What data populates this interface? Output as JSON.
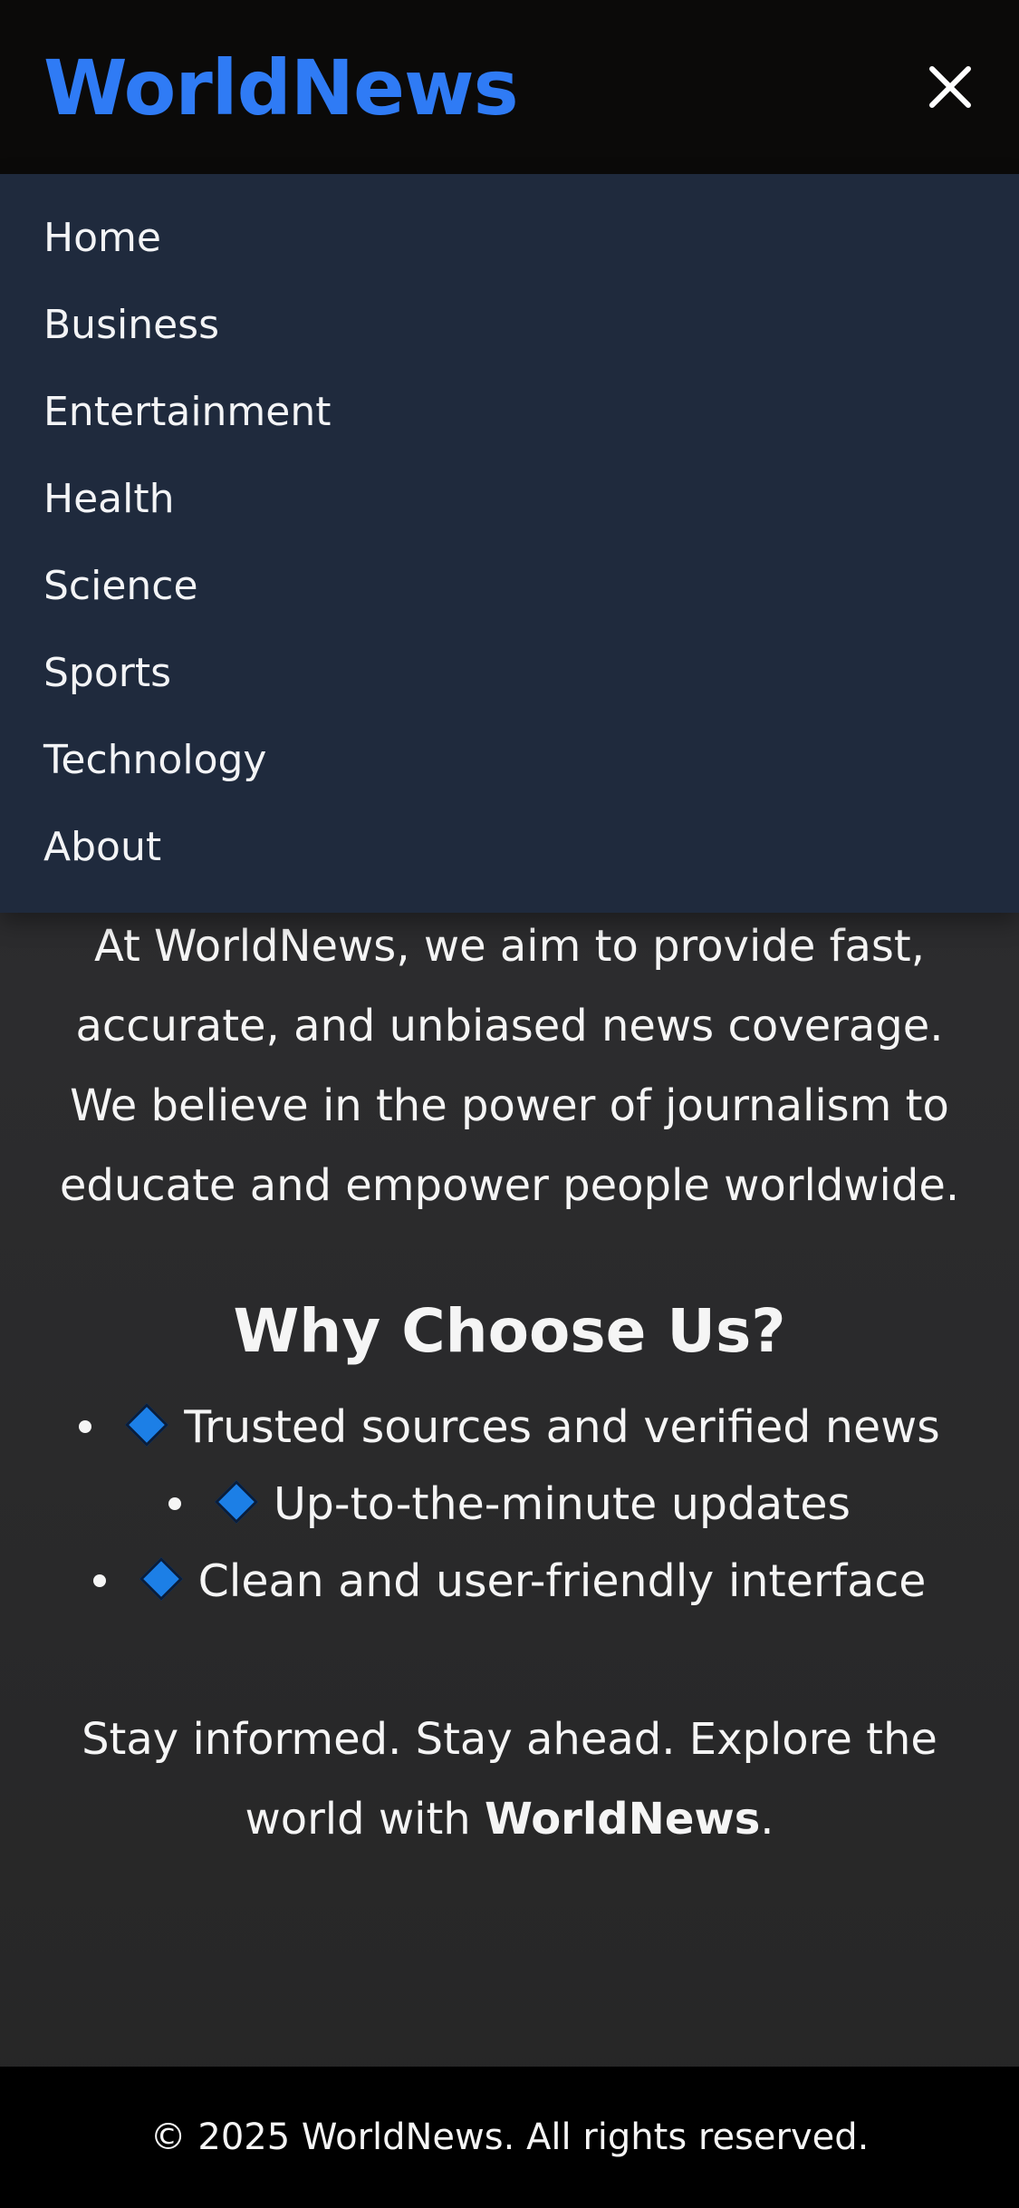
{
  "header": {
    "logo": "WorldNews",
    "close_icon": "close-icon"
  },
  "nav": {
    "items": [
      {
        "label": "Home"
      },
      {
        "label": "Business"
      },
      {
        "label": "Entertainment"
      },
      {
        "label": "Health"
      },
      {
        "label": "Science"
      },
      {
        "label": "Sports"
      },
      {
        "label": "Technology"
      },
      {
        "label": "About"
      }
    ]
  },
  "main": {
    "mission": "At WorldNews, we aim to provide fast, accurate, and unbiased news coverage. We believe in the power of journalism to educate and empower people worldwide.",
    "why_title": "Why Choose Us?",
    "features": [
      {
        "text": "Trusted sources and verified news",
        "icon": "blue-diamond-icon"
      },
      {
        "text": "Up-to-the-minute updates",
        "icon": "blue-diamond-icon"
      },
      {
        "text": "Clean and user-friendly interface",
        "icon": "blue-diamond-icon"
      }
    ],
    "tagline_prefix": "Stay informed. Stay ahead. Explore the world with ",
    "tagline_brand": "WorldNews",
    "tagline_suffix": "."
  },
  "footer": {
    "text": "© 2025 WorldNews. All rights reserved."
  },
  "colors": {
    "brand": "#2f7bf5",
    "header_bg": "#0b0a09",
    "nav_bg": "#1f2a3d",
    "diamond": "#1c7fe6",
    "footer_bg": "#000000"
  }
}
